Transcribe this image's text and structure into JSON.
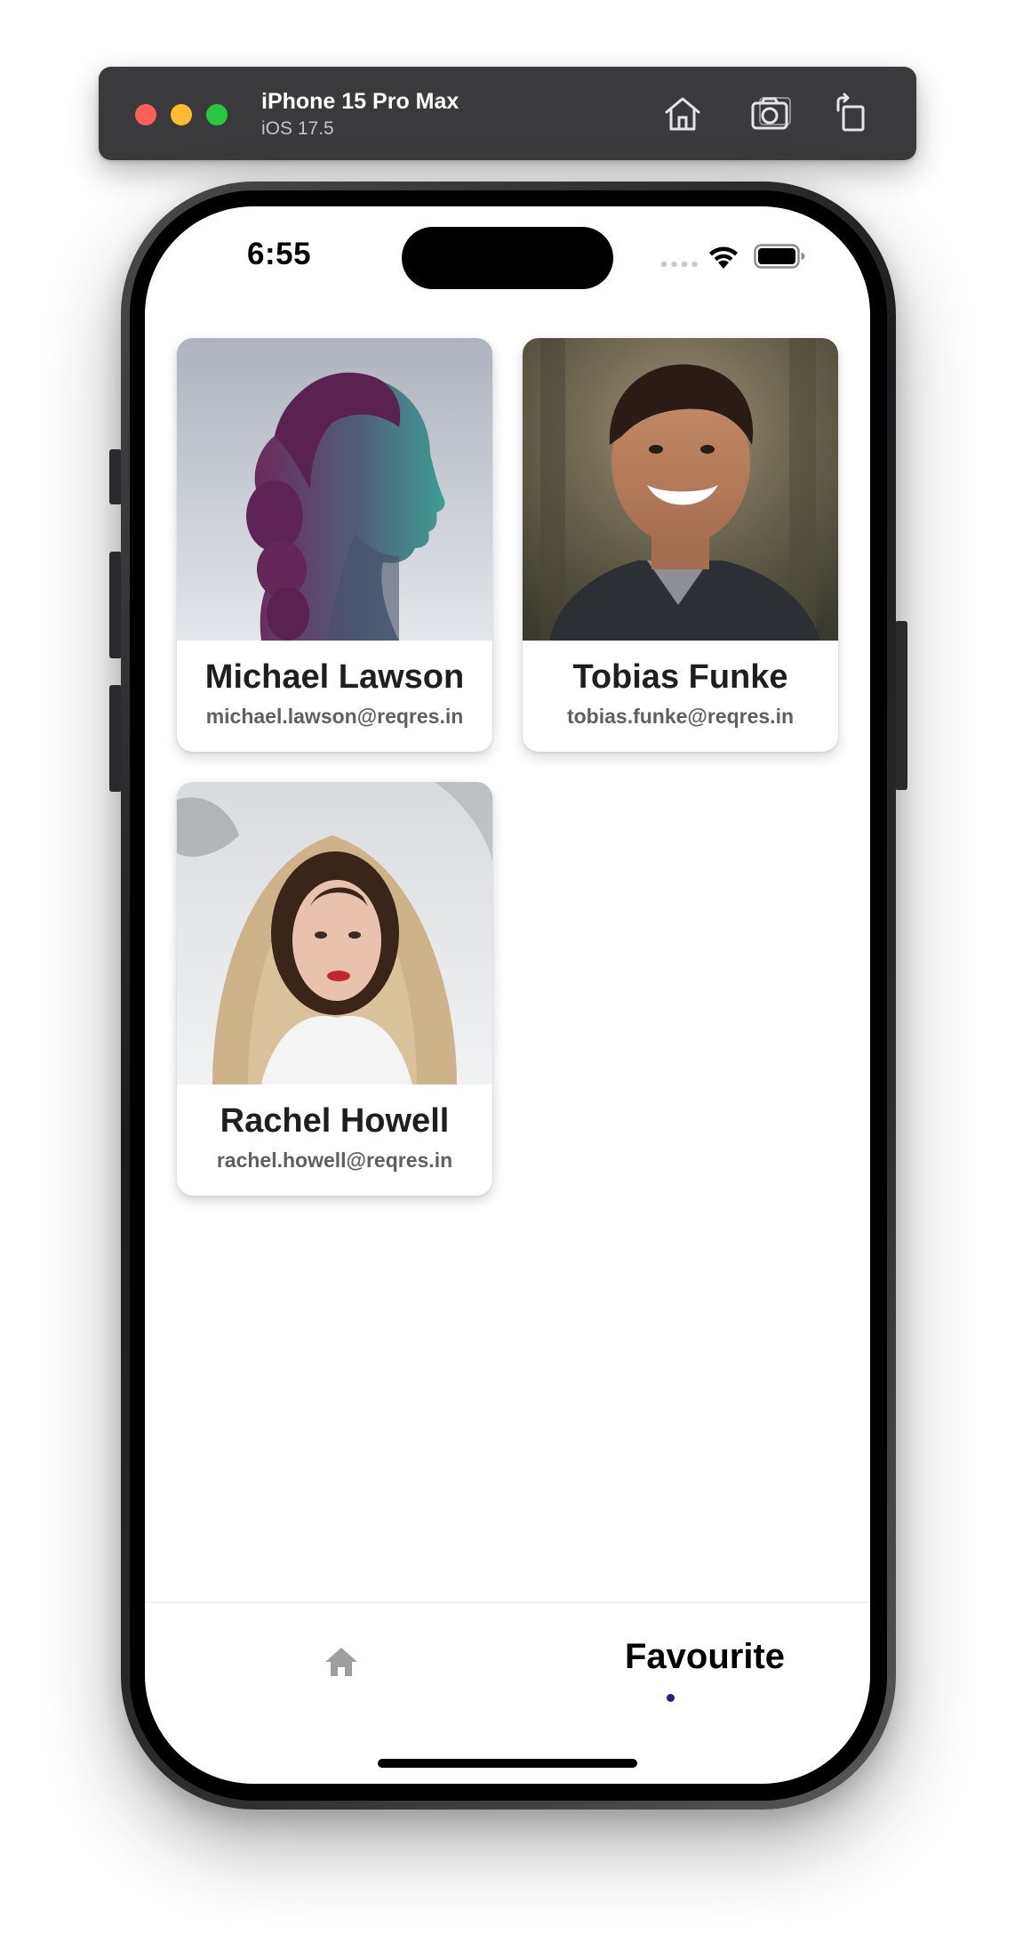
{
  "simulator": {
    "device_name": "iPhone 15 Pro Max",
    "os_version": "iOS 17.5",
    "buttons": [
      {
        "name": "home",
        "icon": "home-icon"
      },
      {
        "name": "screenshot",
        "icon": "camera-icon"
      },
      {
        "name": "rotate",
        "icon": "rotate-icon"
      }
    ],
    "window_controls": [
      "close",
      "minimize",
      "zoom"
    ]
  },
  "status_bar": {
    "time": "6:55",
    "icons": [
      "signal-icon",
      "wifi-icon",
      "battery-icon"
    ]
  },
  "users": [
    {
      "name": "Michael Lawson",
      "email": "michael.lawson@reqres.in",
      "avatar": "woman profile with teal and purple lighting"
    },
    {
      "name": "Tobias Funke",
      "email": "tobias.funke@reqres.in",
      "avatar": "smiling young man outdoors"
    },
    {
      "name": "Rachel Howell",
      "email": "rachel.howell@reqres.in",
      "avatar": "woman in hood in snow"
    }
  ],
  "bottom_nav": {
    "home_icon": "home-icon",
    "active_label": "Favourite",
    "active_indicator_color": "#1a237e"
  },
  "colors": {
    "simulator_bar": "#3a3a3c",
    "close": "#fe5f57",
    "minimize": "#febc2e",
    "zoom": "#28c840",
    "text_primary": "#1f1f22",
    "text_secondary": "#606064",
    "nav_inactive": "#9e9e9e"
  }
}
